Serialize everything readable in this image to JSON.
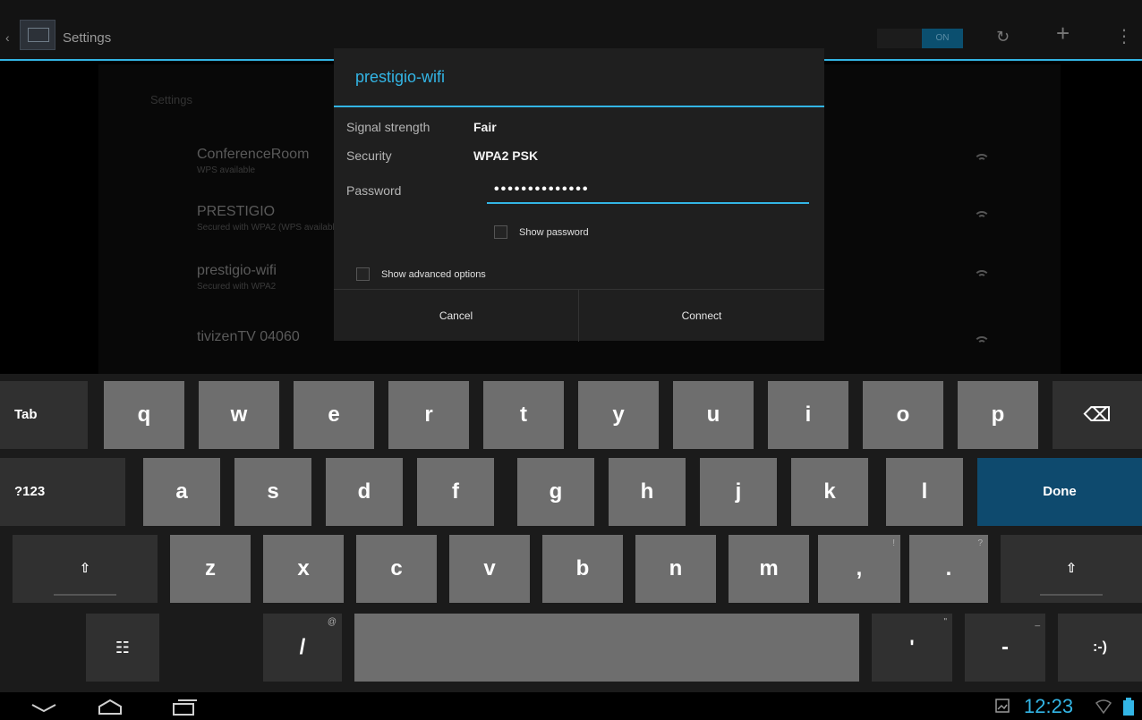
{
  "action_bar": {
    "title": "Settings",
    "switch_label": "ON",
    "up_glyph": "‹",
    "icons": [
      "wps-icon",
      "add-icon",
      "overflow-menu-icon"
    ],
    "wps_glyph": "↻",
    "add_glyph": "+",
    "overflow_glyph": "⋮"
  },
  "settings": {
    "header": "Settings",
    "networks": [
      {
        "name": "ConferenceRoom",
        "status": "WPS available"
      },
      {
        "name": "PRESTIGIO",
        "status": "Secured with WPA2 (WPS available)"
      },
      {
        "name": "prestigio-wifi",
        "status": "Secured with WPA2"
      },
      {
        "name": "tivizenTV 04060",
        "status": ""
      }
    ]
  },
  "dialog": {
    "title": "prestigio-wifi",
    "signal_label": "Signal strength",
    "signal_value": "Fair",
    "security_label": "Security",
    "security_value": "WPA2 PSK",
    "password_label": "Password",
    "password_value": "••••••••••••••",
    "show_password_label": "Show password",
    "show_advanced_label": "Show advanced options",
    "cancel_label": "Cancel",
    "connect_label": "Connect"
  },
  "keyboard": {
    "row1": {
      "tab": "Tab",
      "keys": [
        "q",
        "w",
        "e",
        "r",
        "t",
        "y",
        "u",
        "i",
        "o",
        "p"
      ],
      "backspace_glyph": "⌫"
    },
    "row2": {
      "symbols": "?123",
      "keys": [
        "a",
        "s",
        "d",
        "f",
        "g",
        "h",
        "j",
        "k",
        "l"
      ],
      "done": "Done"
    },
    "row3": {
      "shift_glyph": "⇧",
      "keys": [
        "z",
        "x",
        "c",
        "v",
        "b",
        "n",
        "m"
      ],
      "comma": ",",
      "comma_hint": "!",
      "period": ".",
      "period_hint": "?"
    },
    "row4": {
      "settings_glyph": "☷",
      "slash": "/",
      "slash_hint": "@",
      "apostrophe": "'",
      "apostrophe_hint": "\"",
      "dash": "-",
      "dash_hint": "_",
      "smiley": ":-)"
    }
  },
  "system_bar": {
    "clock": "12:23",
    "back_glyph": "⌵",
    "home_glyph": "⌂",
    "recents_glyph": "▭"
  },
  "colors": {
    "accent": "#33b5e5",
    "done_key": "#0e4a6e",
    "key": "#6e6e6e",
    "func_key": "#303030"
  }
}
